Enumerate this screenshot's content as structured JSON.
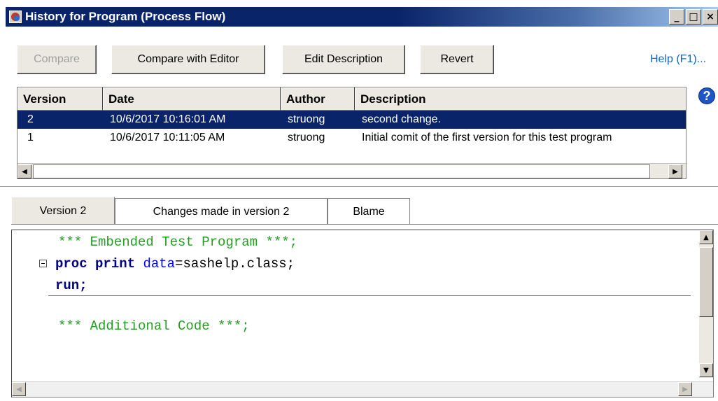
{
  "window": {
    "title": "History for Program (Process Flow)",
    "controls": [
      "_",
      "□",
      "×"
    ]
  },
  "toolbar": {
    "compare_label": "Compare",
    "compare_editor_label": "Compare with Editor",
    "edit_description_label": "Edit Description",
    "revert_label": "Revert",
    "help_label": "Help (F1)..."
  },
  "history": {
    "columns": [
      "Version",
      "Date",
      "Author",
      "Description"
    ],
    "rows": [
      {
        "version": "2",
        "date": "10/6/2017 10:16:01 AM",
        "author": "struong",
        "description": "second change."
      },
      {
        "version": "1",
        "date": "10/6/2017 10:11:05 AM",
        "author": "struong",
        "description": "Initial comit of the first version for this test program"
      }
    ],
    "selected_row": 0
  },
  "tabs": [
    "Version 2",
    "Changes made in version 2",
    "Blame"
  ],
  "editor": {
    "line1": "*** Embended Test Program ***;",
    "line2_kw": "proc",
    "line2_kw2": "print",
    "line2_opt": "data",
    "line2_rest": "=sashelp.class;",
    "line3": "run;",
    "line4": "*** Additional Code ***;"
  },
  "icons": {
    "help": "?"
  }
}
